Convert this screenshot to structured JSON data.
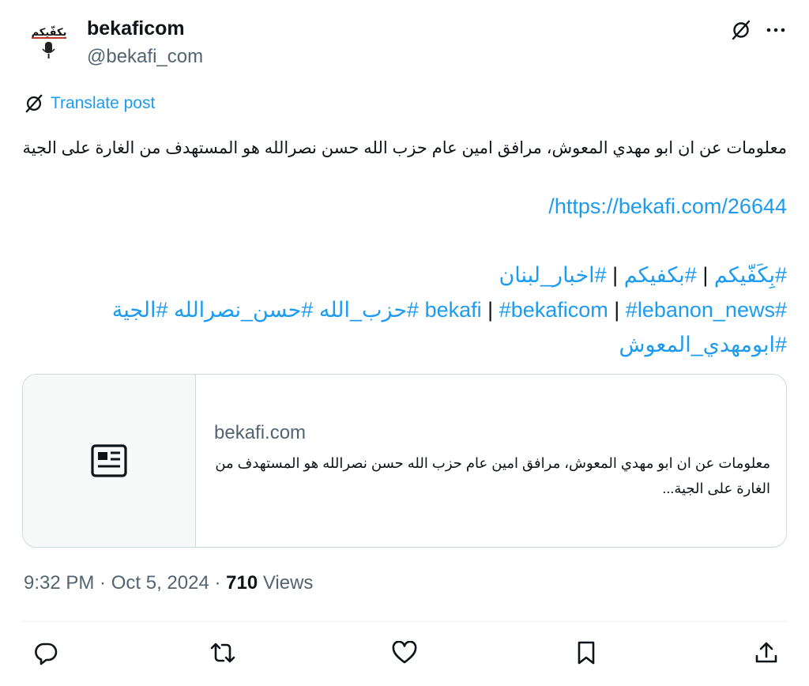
{
  "author": {
    "display_name": "bekaficom",
    "handle": "@bekafi_com",
    "avatar_logo_text": "بكفّيكم"
  },
  "top_icons": [
    "grok-icon",
    "more-icon"
  ],
  "translate_label": "Translate post",
  "post_text": "معلومات عن ان ابو مهدي المعوش، مرافق امين عام حزب الله حسن نصرالله هو المستهدف من الغارة  على الجية",
  "link_url": "https://bekafi.com/26644/",
  "hashtags_line1": {
    "tag1": "#بِكَفّيكم",
    "sep1": " | ",
    "tag2": "#بكفيكم",
    "sep2": " | ",
    "tag3": "#اخبار_لبنان"
  },
  "hashtags_line2": {
    "tag1": "#bekafi",
    "sep1": " | ",
    "tag2": "#bekaficom",
    "sep2": " | ",
    "tag3": "#lebanon_news",
    "tag4": "#حزب_الله",
    "tag5": "#حسن_نصرالله",
    "tag6": "#الجية"
  },
  "hashtags_line3": {
    "tag1": "#ابومهدي_المعوش"
  },
  "card": {
    "domain": "bekafi.com",
    "description": "معلومات عن ان ابو مهدي المعوش، مرافق امين عام حزب الله حسن نصرالله هو المستهدف من الغارة على الجية..."
  },
  "meta": {
    "time": "9:32 PM",
    "dot1": " · ",
    "date": "Oct 5, 2024",
    "dot2": " · ",
    "views_count": "710",
    "views_label": " Views"
  },
  "actions": [
    "reply-icon",
    "repost-icon",
    "like-icon",
    "bookmark-icon",
    "share-icon"
  ],
  "colors": {
    "accent": "#1d9bf0",
    "text": "#0f1419",
    "secondary": "#536471",
    "border": "#cfd9de"
  }
}
